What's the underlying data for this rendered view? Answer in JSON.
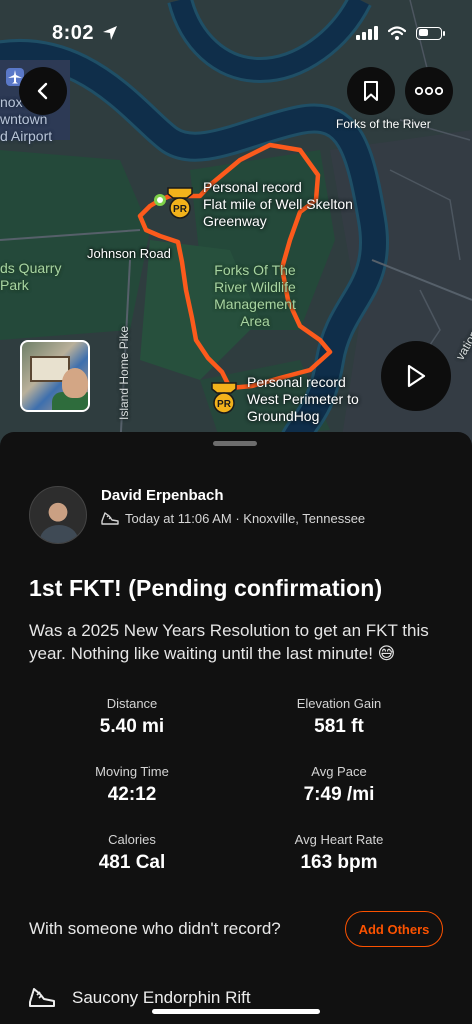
{
  "status": {
    "time": "8:02"
  },
  "map": {
    "labels": {
      "forks_of_the_river": "Forks of the River",
      "johnson_road": "Johnson Road",
      "quarry_park": "ds Quarry\nPark",
      "airport": "noxv\nwntown\nd Airport",
      "wildlife_area": "Forks Of The\nRiver Wildlife\nManagement\nArea",
      "island_home_pike": "Island Home Pike",
      "vation": "vation"
    },
    "segments": [
      {
        "badge": "PR",
        "text": "Personal record\nFlat mile of Well Skelton\nGreenway"
      },
      {
        "badge": "PR",
        "text": "Personal record\nWest Perimeter to\nGroundHog"
      }
    ]
  },
  "athlete": {
    "name": "David Erpenbach",
    "meta": "Today at 11:06 AM · Knoxville, Tennessee"
  },
  "activity": {
    "title": "1st FKT! (Pending confirmation)",
    "description": "Was a 2025 New Years Resolution to get an FKT this year. Nothing like waiting until the last minute! 😅"
  },
  "stats": {
    "distance": {
      "label": "Distance",
      "value": "5.40 mi"
    },
    "elevation": {
      "label": "Elevation Gain",
      "value": "581 ft"
    },
    "moving_time": {
      "label": "Moving Time",
      "value": "42:12"
    },
    "avg_pace": {
      "label": "Avg Pace",
      "value": "7:49 /mi"
    },
    "calories": {
      "label": "Calories",
      "value": "481 Cal"
    },
    "avg_hr": {
      "label": "Avg Heart Rate",
      "value": "163 bpm"
    }
  },
  "others": {
    "question": "With someone who didn't record?",
    "button": "Add Others"
  },
  "gear": {
    "name": "Saucony Endorphin Rift"
  },
  "colors": {
    "accent": "#fc5200",
    "route": "#fc5a1c",
    "pr_gold": "#f2b21b"
  }
}
